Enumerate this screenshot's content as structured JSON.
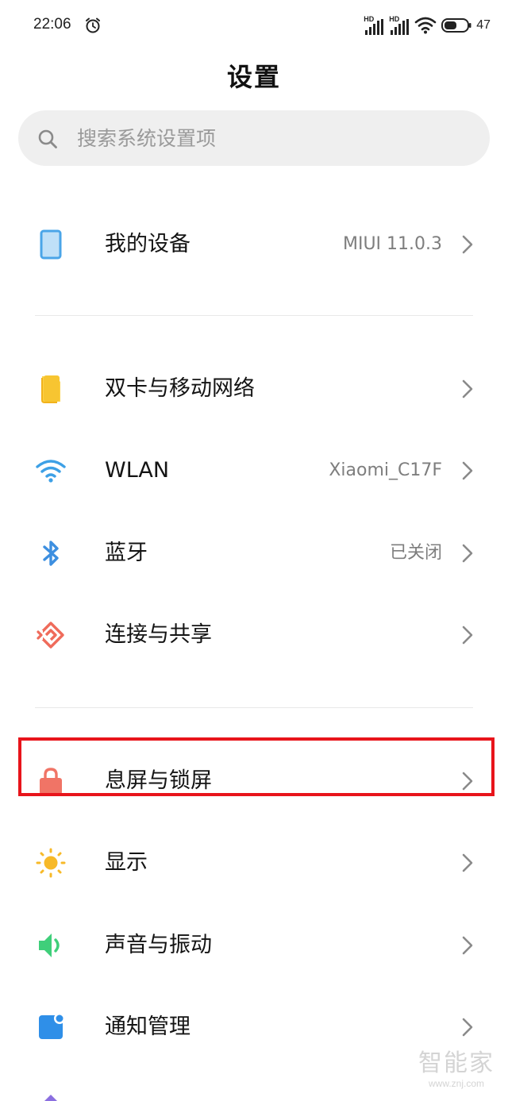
{
  "status_bar": {
    "time": "22:06",
    "signal_1": "HD",
    "signal_2": "HD",
    "battery": "47"
  },
  "page": {
    "title": "设置"
  },
  "search": {
    "placeholder": "搜索系统设置项"
  },
  "items": [
    {
      "label": "我的设备",
      "value": "MIUI 11.0.3",
      "icon": "tablet-icon",
      "color": "#4aa5e8"
    },
    {
      "label": "双卡与移动网络",
      "value": "",
      "icon": "sim-card-icon",
      "color": "#f7c531"
    },
    {
      "label": "WLAN",
      "value": "Xiaomi_C17F",
      "icon": "wifi-icon",
      "color": "#3da0e6"
    },
    {
      "label": "蓝牙",
      "value": "已关闭",
      "icon": "bluetooth-icon",
      "color": "#3d8fe0"
    },
    {
      "label": "连接与共享",
      "value": "",
      "icon": "share-connection-icon",
      "color": "#ef6b5b"
    },
    {
      "label": "息屏与锁屏",
      "value": "",
      "icon": "lock-icon",
      "color": "#f07466"
    },
    {
      "label": "显示",
      "value": "",
      "icon": "sun-icon",
      "color": "#f7b928"
    },
    {
      "label": "声音与振动",
      "value": "",
      "icon": "speaker-icon",
      "color": "#3fcf7a"
    },
    {
      "label": "通知管理",
      "value": "",
      "icon": "notification-icon",
      "color": "#2f8fe8"
    }
  ],
  "watermark": {
    "main": "智能家",
    "sub": "www.znj.com"
  },
  "colors": {
    "highlight": "#e8141b",
    "search_bg": "#efefef"
  }
}
